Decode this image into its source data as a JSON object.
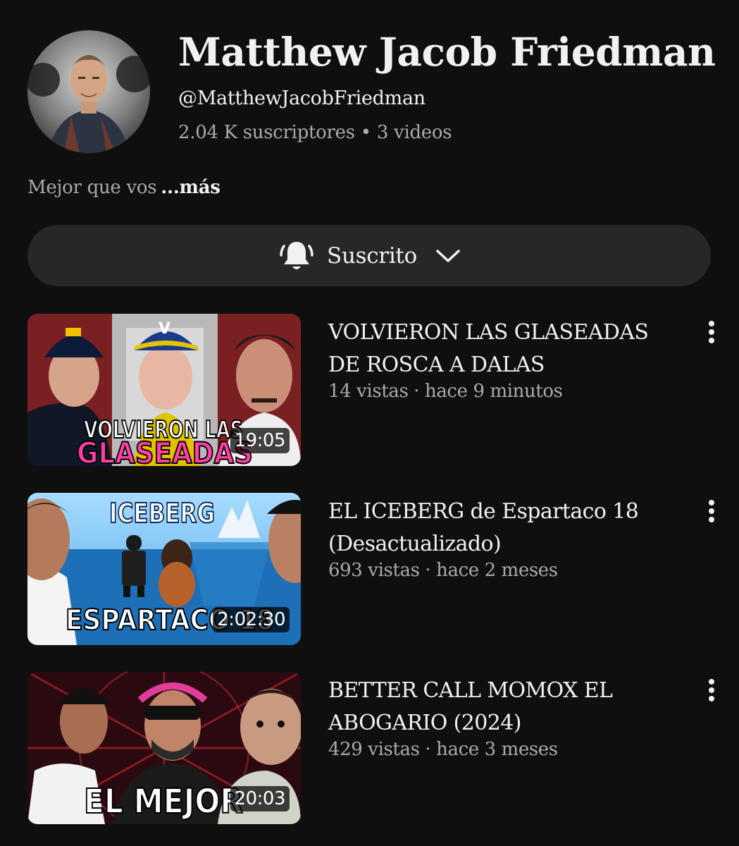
{
  "channel": {
    "name": "Matthew Jacob Friedman",
    "handle": "@MatthewJacobFriedman",
    "subscribers": "2.04 K suscriptores",
    "separator": "•",
    "video_count": "3 videos",
    "description": "Mejor que vos",
    "more_label": "...más"
  },
  "subscribe_button": {
    "label": "Suscrito",
    "icon": "bell-icon",
    "chevron": "chevron-down-icon"
  },
  "videos": [
    {
      "title": "VOLVIERON LAS GLASEADAS DE ROSCA A DALAS",
      "meta": "14 vistas · hace 9 minutos",
      "duration": "19:05",
      "thumb_text_top": "VOLVIERON LAS",
      "thumb_text_bottom": "GLASEADAS"
    },
    {
      "title": "EL ICEBERG de Espartaco 18 (Desactualizado)",
      "meta": "693 vistas · hace 2 meses",
      "duration": "2:02:30",
      "thumb_text_top": "ICEBERG",
      "thumb_text_bottom": "ESPARTACO 18"
    },
    {
      "title": "BETTER CALL MOMOX EL ABOGARIO (2024)",
      "meta": "429 vistas · hace 3 meses",
      "duration": "20:03",
      "thumb_text_top": "",
      "thumb_text_bottom": "EL MEJOR"
    }
  ],
  "colors": {
    "background": "#0f0f0f",
    "pill": "#272727",
    "primary_text": "#f1f1f1",
    "secondary_text": "#aaaaaa"
  }
}
